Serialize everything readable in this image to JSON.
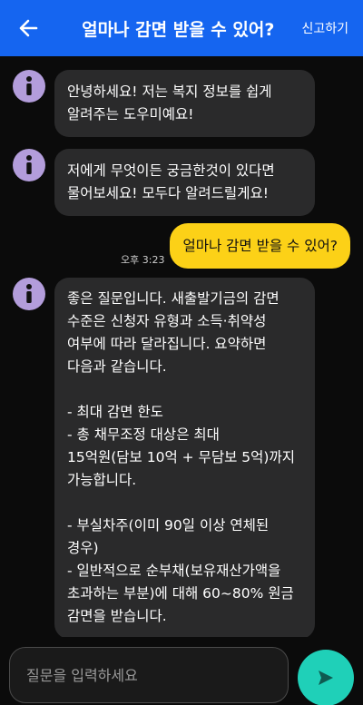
{
  "header": {
    "title": "얼마나 감면 받을 수 있어?",
    "report_label": "신고하기",
    "back_icon": "arrow-left-icon",
    "color": "#1565f0"
  },
  "messages": [
    {
      "sender": "bot",
      "text": "안녕하세요! 저는 복지 정보를 쉽게\n알려주는 도우미예요!"
    },
    {
      "sender": "bot",
      "text": "저에게 무엇이든 궁금한것이 있다면\n물어보세요! 모두다 알려드릴게요!"
    },
    {
      "sender": "user",
      "text": "얼마나 감면 받을 수 있어?",
      "time": "오후 3:23"
    },
    {
      "sender": "bot",
      "text": "좋은 질문입니다. 새출발기금의 감면\n수준은 신청자 유형과 소득·취약성\n여부에 따라 달라집니다. 요약하면\n다음과 같습니다.\n\n- 최대 감면 한도\n- 총 채무조정 대상은 최대\n15억원(담보 10억 + 무담보 5억)까지\n가능합니다.\n\n- 부실차주(이미 90일 이상 연체된\n경우)\n- 일반적으로 순부채(보유재산가액을\n초과하는 부분)에 대해 60~80% 원금\n감면을 받습니다."
    }
  ],
  "input": {
    "placeholder": "질문을 입력하세요",
    "value": ""
  },
  "send_icon": "send-icon",
  "colors": {
    "user_bubble": "#fcd117",
    "bot_bubble": "#2a2a2b",
    "avatar": "#b39ddb",
    "send_button": "#1fd0b8"
  }
}
